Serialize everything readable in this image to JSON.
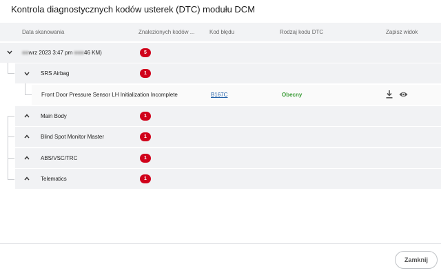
{
  "dialog": {
    "title": "Kontrola diagnostycznych kodów usterek (DTC) modułu DCM",
    "close_label": "Zamknij"
  },
  "table": {
    "columns": [
      "Data skanowania",
      "Znalezionych kodów ...",
      "Kod błędu",
      "Rodzaj kodu DTC",
      "Zapisz widok"
    ]
  },
  "scan": {
    "date_prefix": "",
    "date_text": "wrz 2023 3:47 pm",
    "date_suffix_blur": "",
    "date_suffix": "46 KM)",
    "count": "5"
  },
  "modules": [
    {
      "name": "SRS Airbag",
      "count": "1",
      "expanded": true
    },
    {
      "name": "Main Body",
      "count": "1",
      "expanded": false
    },
    {
      "name": "Blind Spot Monitor Master",
      "count": "1",
      "expanded": false
    },
    {
      "name": "ABS/VSC/TRC",
      "count": "1",
      "expanded": false
    },
    {
      "name": "Telematics",
      "count": "1",
      "expanded": false
    }
  ],
  "dtc": {
    "description": "Front Door Pressure Sensor LH Initialization Incomplete",
    "code": "B167C",
    "status": "Obecny"
  },
  "icons": {
    "download": "download-icon",
    "view": "eye-icon"
  },
  "colors": {
    "badge": "#d0021b",
    "status": "#3a9b36",
    "link": "#1f5fa8"
  }
}
